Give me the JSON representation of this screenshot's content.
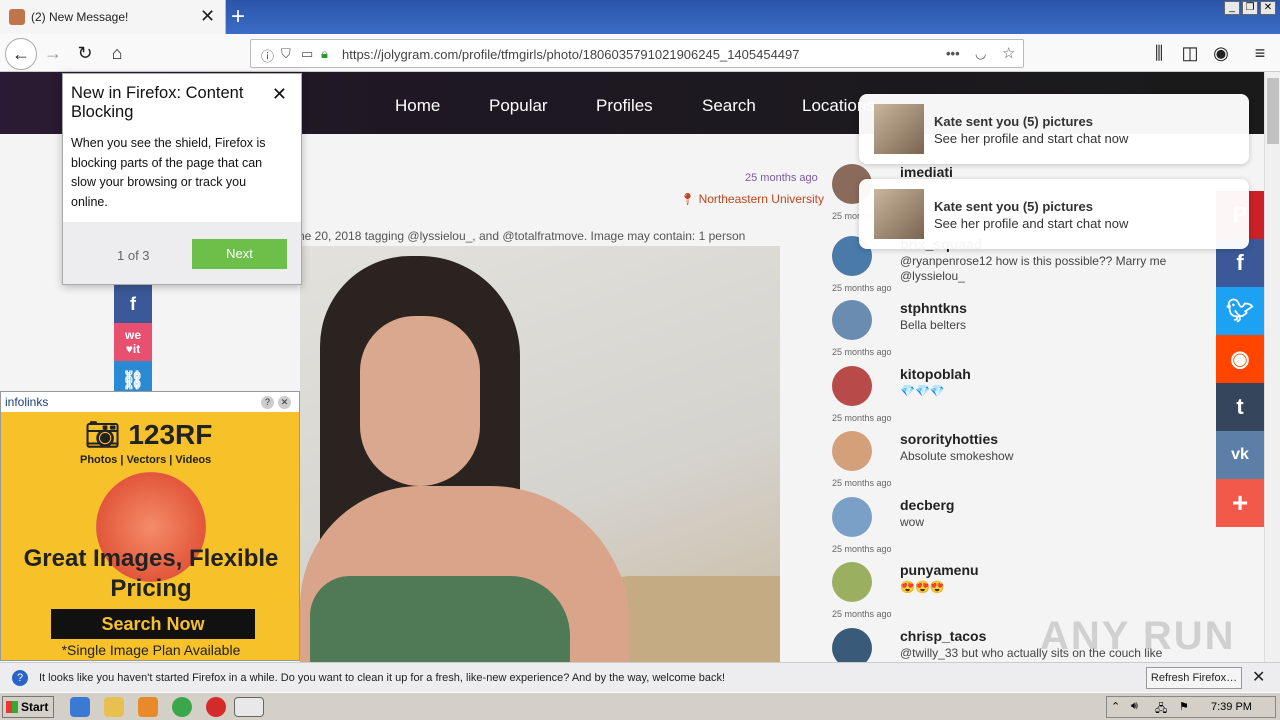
{
  "browser": {
    "tab_title": "(2) New Message!",
    "new_tab": "+",
    "url": "https://jolygram.com/profile/tfmgirls/photo/1806035791021906245_1405454497",
    "url_menu": "•••"
  },
  "site_nav": [
    "Home",
    "Popular",
    "Profiles",
    "Search",
    "Locations"
  ],
  "doorhanger": {
    "title": "New in Firefox: Content Blocking",
    "body": "When you see the shield, Firefox is blocking parts of the page that can slow your browsing or track you online.",
    "step": "1 of 3",
    "next": "Next"
  },
  "post": {
    "time": "25 months ago",
    "location": "Northeastern University",
    "caption": "ne 20, 2018 tagging @lyssielou_, and @totalfratmove. Image may contain: 1 person"
  },
  "notifications": [
    {
      "title": "Kate sent you (5) pictures",
      "subtitle": "See her profile and start chat now"
    },
    {
      "title": "Kate sent you (5) pictures",
      "subtitle": "See her profile and start chat now"
    }
  ],
  "comments": [
    {
      "user": "imediati",
      "text": "",
      "time": "25 months ago",
      "color": "#8a6a5a"
    },
    {
      "user": "brix_squaad",
      "text": "@ryanpenrose12 how is this possible?? Marry me @lyssielou_",
      "time": "25 months ago",
      "color": "#4a7aa8"
    },
    {
      "user": "stphntkns",
      "text": "Bella belters",
      "time": "25 months ago",
      "color": "#6a8cb0"
    },
    {
      "user": "kitopoblah",
      "text": "💎💎💎",
      "time": "25 months ago",
      "color": "#b84a4a"
    },
    {
      "user": "sororityhotties",
      "text": "Absolute smokeshow",
      "time": "25 months ago",
      "color": "#d4a07a"
    },
    {
      "user": "decberg",
      "text": "wow",
      "time": "25 months ago",
      "color": "#7aa0c8"
    },
    {
      "user": "punyamenu",
      "text": "😍😍😍",
      "time": "25 months ago",
      "color": "#9ab060"
    },
    {
      "user": "chrisp_tacos",
      "text": "@twilly_33 but who actually sits on the couch like",
      "time": "",
      "color": "#3a5a7a"
    }
  ],
  "ad": {
    "network": "infolinks",
    "brand": "123RF",
    "subtitle": "Photos | Vectors | Videos",
    "headline": "Great Images, Flexible Pricing",
    "cta": "Search Now",
    "fine": "*Single Image Plan Available"
  },
  "notice_bar": {
    "message": "It looks like you haven't started Firefox in a while. Do you want to clean it up for a fresh, like-new experience? And by the way, welcome back!",
    "button": "Refresh Firefox…"
  },
  "taskbar": {
    "start": "Start",
    "clock": "7:39 PM"
  },
  "watermark": "ANY RUN"
}
